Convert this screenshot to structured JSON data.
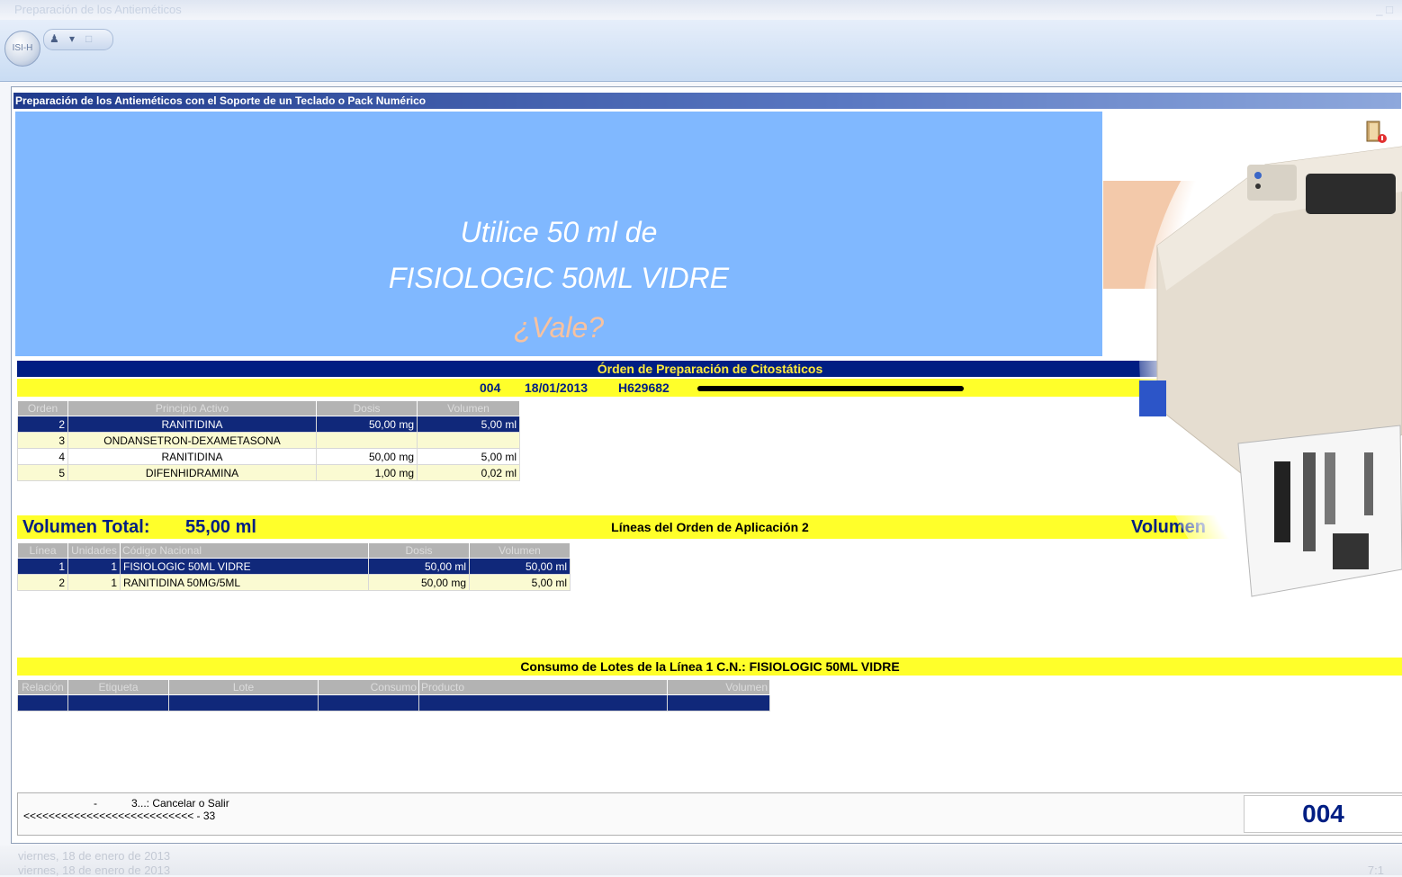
{
  "window": {
    "title": "Preparación de los Antieméticos",
    "controls": "_ □"
  },
  "ribbon": {
    "orb_label": "ISI-H"
  },
  "form": {
    "title": "Preparación de los Antieméticos con el Soporte de un Teclado o Pack Numérico"
  },
  "prompt": {
    "line1": "Utilice 50 ml de",
    "line2": "FISIOLOGIC 50ML VIDRE",
    "line3": "¿Vale?"
  },
  "order": {
    "header": "Órden de Preparación de Citostáticos",
    "number": "004",
    "date": "18/01/2013",
    "patient_id": "H629682"
  },
  "order_table": {
    "columns": [
      "Orden",
      "Principio Activo",
      "Dosis",
      "Volumen"
    ],
    "rows": [
      {
        "orden": "2",
        "principio": "RANITIDINA",
        "dosis": "50,00 mg",
        "volumen": "5,00 ml"
      },
      {
        "orden": "3",
        "principio": "ONDANSETRON-DEXAMETASONA",
        "dosis": "",
        "volumen": ""
      },
      {
        "orden": "4",
        "principio": "RANITIDINA",
        "dosis": "50,00 mg",
        "volumen": "5,00 ml"
      },
      {
        "orden": "5",
        "principio": "DIFENHIDRAMINA",
        "dosis": "1,00 mg",
        "volumen": "0,02 ml"
      }
    ]
  },
  "volume_bar": {
    "label": "Volumen Total:",
    "value": "55,00 ml",
    "center": "Líneas del Orden de Aplicación 2",
    "right": "Volumen"
  },
  "lines_table": {
    "columns": [
      "Línea",
      "Unidades",
      "Código Nacional",
      "Dosis",
      "Volumen"
    ],
    "rows": [
      {
        "linea": "1",
        "unidades": "1",
        "codigo": "FISIOLOGIC 50ML VIDRE",
        "dosis": "50,00 ml",
        "volumen": "50,00 ml"
      },
      {
        "linea": "2",
        "unidades": "1",
        "codigo": "RANITIDINA 50MG/5ML",
        "dosis": "50,00 mg",
        "volumen": "5,00 ml"
      }
    ]
  },
  "lots": {
    "header": "Consumo de Lotes de la Línea 1 C.N.: FISIOLOGIC 50ML VIDRE",
    "columns": [
      "Relación",
      "Etiqueta",
      "Lote",
      "Consumo",
      "Producto",
      "Volumen"
    ]
  },
  "status": {
    "dash": "-",
    "line1": "3...: Cancelar  o  Salir",
    "line2": "<<<<<<<<<<<<<<<<<<<<<<<<<<< -  33",
    "code": "004"
  },
  "footer": {
    "line1": "viernes, 18 de enero de 2013",
    "line2": "viernes, 18 de enero de 2013",
    "right": "7:1"
  },
  "colors": {
    "dark_blue": "#001e83",
    "yellow": "#ffff2a",
    "panel_blue": "#80b8ff",
    "selected_row": "#10287a"
  }
}
